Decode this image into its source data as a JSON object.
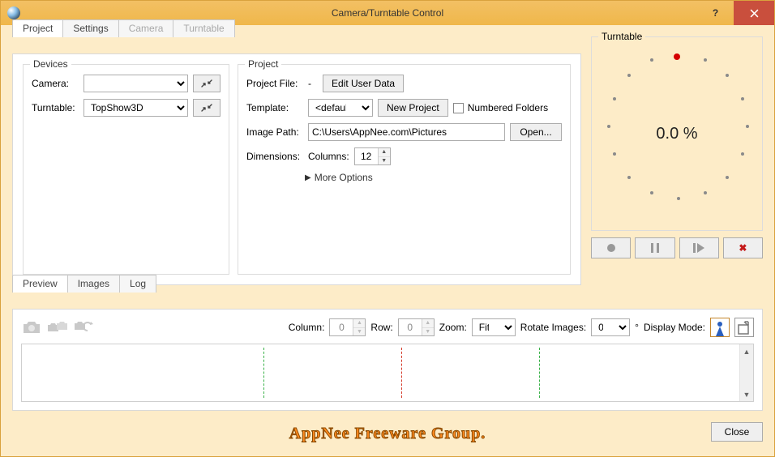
{
  "title": "Camera/Turntable Control",
  "main_tabs": {
    "project": "Project",
    "settings": "Settings",
    "camera": "Camera",
    "turntable": "Turntable"
  },
  "devices": {
    "legend": "Devices",
    "camera_label": "Camera:",
    "camera_value": "",
    "turntable_label": "Turntable:",
    "turntable_value": "TopShow3D"
  },
  "project": {
    "legend": "Project",
    "file_label": "Project File:",
    "file_value": "-",
    "edit_user_data": "Edit User Data",
    "template_label": "Template:",
    "template_value": "<default>",
    "new_project": "New Project",
    "numbered_folders": "Numbered Folders",
    "image_path_label": "Image Path:",
    "image_path_value": "C:\\Users\\AppNee.com\\Pictures",
    "open": "Open...",
    "dimensions_label": "Dimensions:",
    "columns_label": "Columns:",
    "columns_value": "12",
    "more_options": "More Options"
  },
  "turntable_panel": {
    "legend": "Turntable",
    "percent": "0.0 %"
  },
  "preview_tabs": {
    "preview": "Preview",
    "images": "Images",
    "log": "Log"
  },
  "preview_toolbar": {
    "column_label": "Column:",
    "column_value": "0",
    "row_label": "Row:",
    "row_value": "0",
    "zoom_label": "Zoom:",
    "zoom_value": "Fit",
    "rotate_label": "Rotate Images:",
    "rotate_value": "0",
    "degree": "°",
    "display_mode_label": "Display Mode:"
  },
  "footer": {
    "watermark": "AppNee Freeware Group.",
    "close": "Close"
  }
}
